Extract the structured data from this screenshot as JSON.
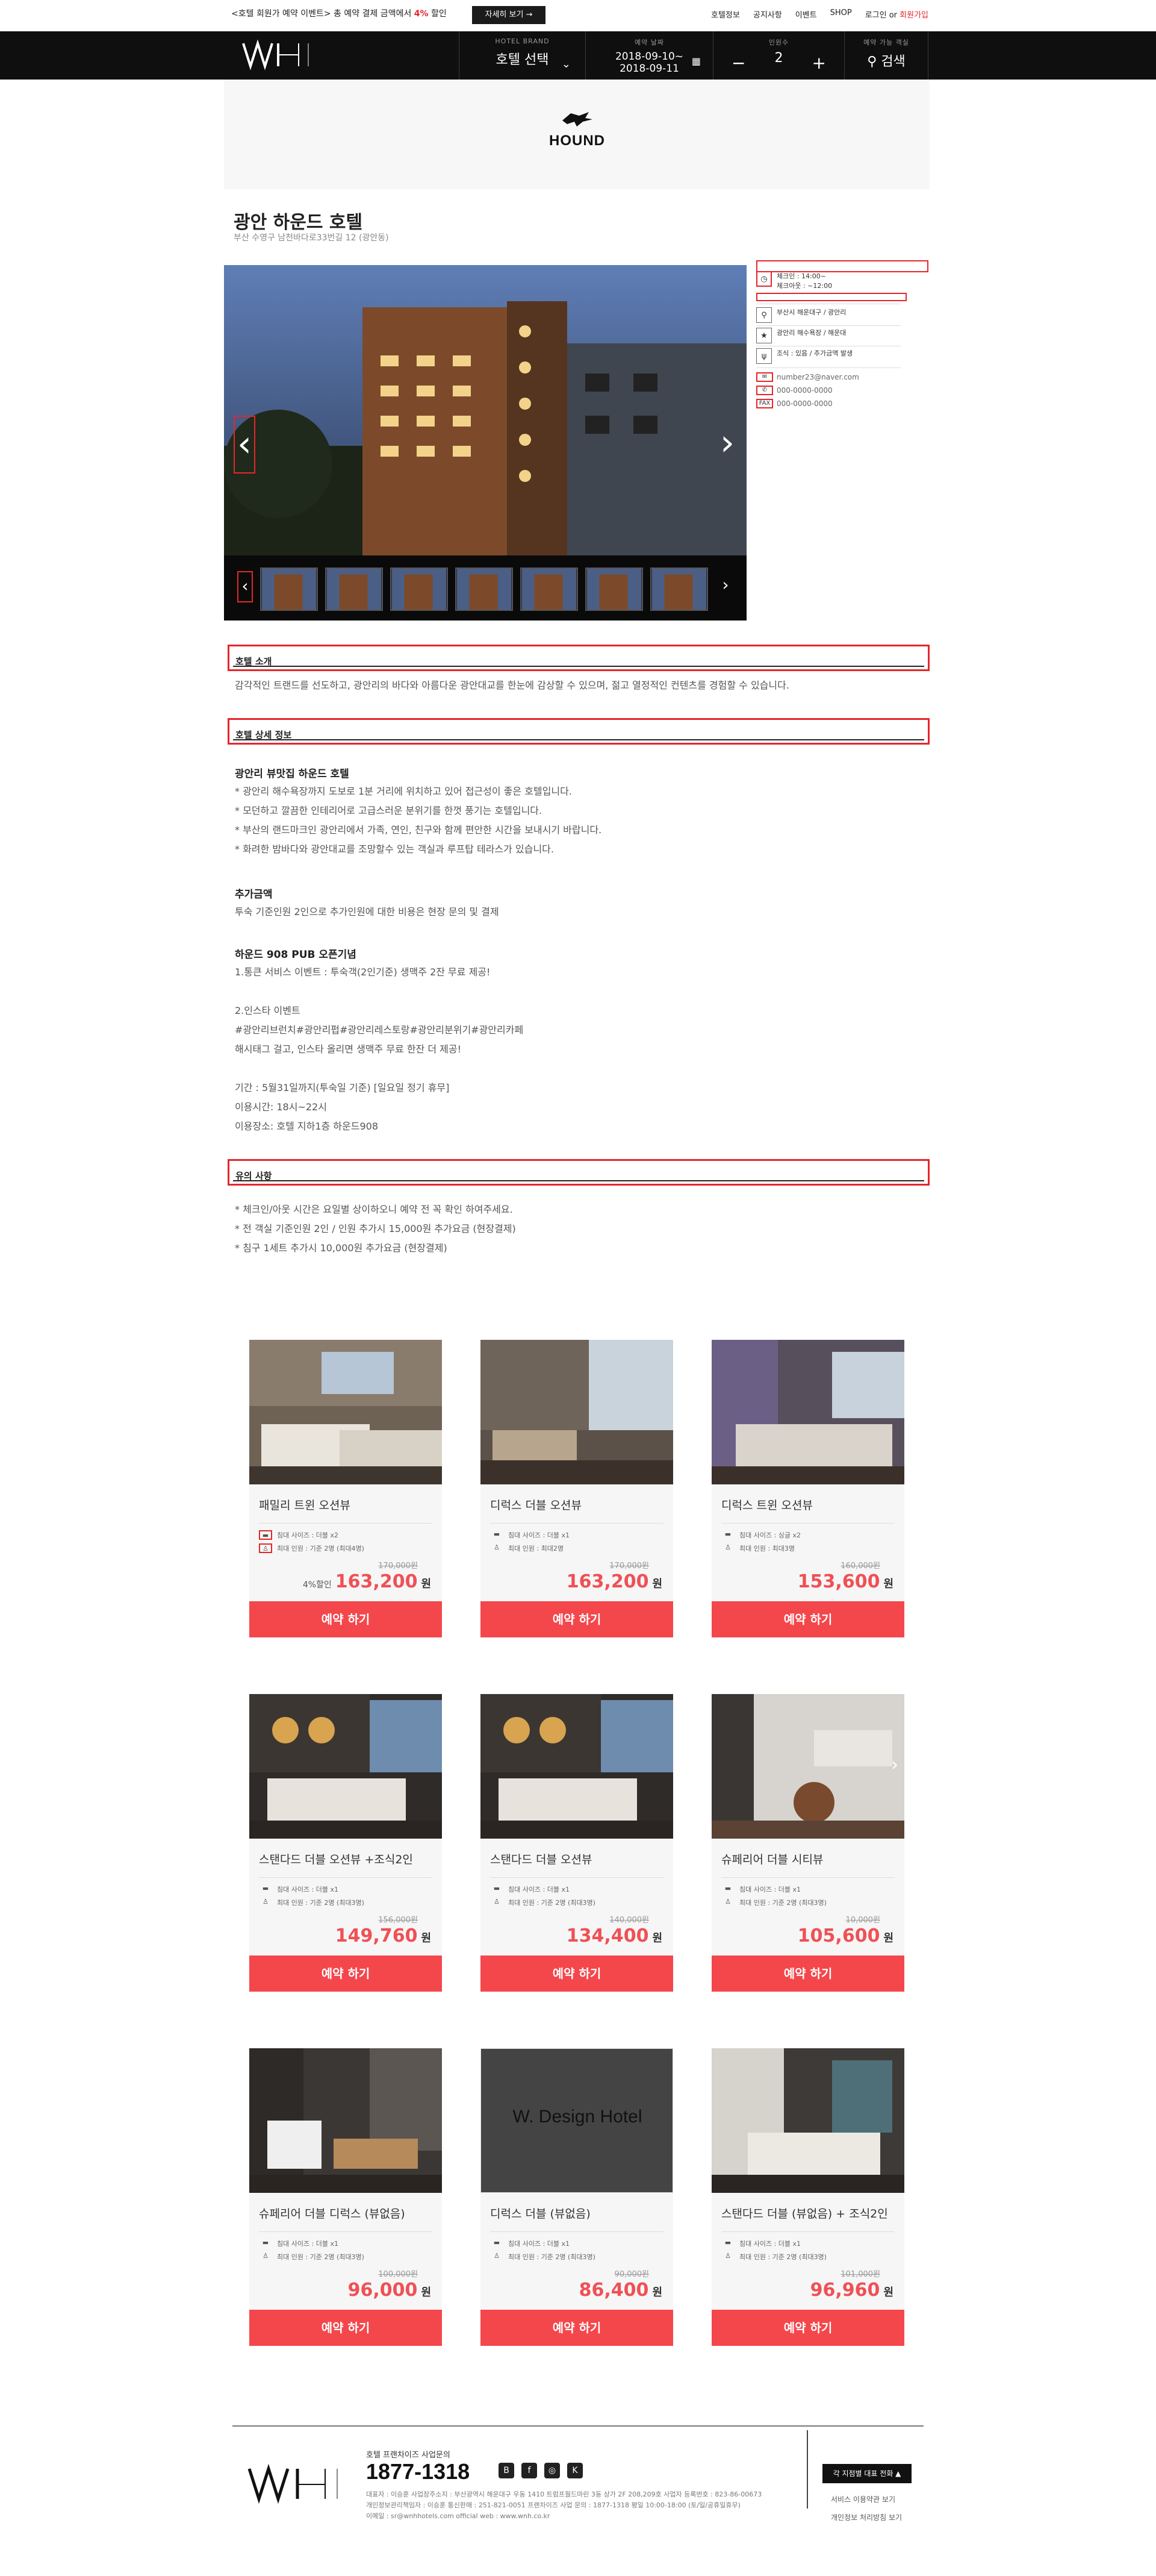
{
  "topbar": {
    "promo_prefix": "<호텔 회원가 예약 이벤트> 총 예약 결제 금액에서 ",
    "promo_pct": "4%",
    "promo_suffix": " 할인",
    "promo_button": "자세히 보기 →",
    "links": [
      "호텔정보",
      "공지사항",
      "이벤트",
      "SHOP",
      "로그인 or"
    ],
    "signup": "회원가입"
  },
  "header": {
    "brand_label": "HOTEL BRAND",
    "brand_value": "호텔 선택",
    "date_label": "예약 날짜",
    "date_from": "2018-09-10~",
    "date_to": "2018-09-11",
    "people_label": "인원수",
    "people_value": "2",
    "search_label": "예약 가능 객실",
    "search_value": "검색"
  },
  "banner": {
    "brand": "HOUND"
  },
  "hotel": {
    "name": "광안 하운드 호텔",
    "address": "부산 수영구 남천바다로33번길 12 (광안동)"
  },
  "info": {
    "checkin": "체크인       : 14:00~",
    "checkout": "체크아웃  : ~12:00",
    "location": "부산시 해운대구 / 광안리",
    "nearby": "광안리 해수욕장 / 해운대",
    "breakfast": "조식 : 있음 / 추가금액 발생",
    "email": "number23@naver.com",
    "phone": "000-0000-0000",
    "fax_label": "FAX",
    "fax": "000-0000-0000"
  },
  "sections": {
    "intro_title": "호텔 소개",
    "intro_text": "감각적인 트랜드를 선도하고, 광안리의 바다와 아름다운 광안대교를 한눈에 감상할 수 있으며, 젊고 열정적인 컨텐츠를 경험할 수 있습니다.",
    "detail_title": "호텔 상세 정보",
    "detail_sub1": "광안리 뷰맛집 하운드 호텔",
    "detail_lines1": [
      "* 광안리 해수욕장까지 도보로 1분 거리에 위치하고 있어 접근성이 좋은 호텔입니다.",
      "* 모던하고 깔끔한 인테리어로 고급스러운 분위기를 한껏 풍기는 호텔입니다.",
      "* 부산의 랜드마크인 광안리에서 가족, 연인, 친구와 함께 편안한 시간을 보내시기 바랍니다.",
      "* 화려한 밤바다와 광안대교를 조망할수 있는 객실과 루프탑 테라스가 있습니다."
    ],
    "detail_sub2": "추가금액",
    "detail_lines2": [
      "투숙 기준인원 2인으로 추가인원에 대한 비용은 현장 문의 및 결제"
    ],
    "detail_sub3": "하운드 908 PUB 오픈기념",
    "detail_lines3": [
      "1.통큰 서비스 이벤트 : 투숙객(2인기준) 생맥주 2잔 무료 제공!",
      "",
      "2.인스타 이벤트",
      "#광안리브런치#광안리펍#광안리레스토랑#광안리분위기#광안리카페",
      "해시태그 걸고, 인스타 올리면 생맥주 무료 한잔 더 제공!",
      "",
      "기간 : 5월31일까지(투숙일 기준) [일요일 정기 휴무]",
      "이용시간: 18시~22시",
      "이용장소: 호텔 지하1층 하운드908"
    ],
    "notice_title": "유의 사항",
    "notice_lines": [
      "* 체크인/아웃 시간은 요일별 상이하오니 예약 전 꼭 확인 하여주세요.",
      "* 전 객실 기준인원 2인 / 인원 추가시 15,000원 추가요금 (현장결제)",
      "* 침구 1세트 추가시 10,000원 추가요금 (현장결제)"
    ]
  },
  "rooms": [
    {
      "name": "패밀리 트윈 오션뷰",
      "bed": "침대 사이즈 : 더블 x2",
      "cap": "최대 인원 : 기준 2명 (최대4명)",
      "old": "170,000원",
      "disc": "4%할인",
      "price": "163,200",
      "won": "원",
      "book": "예약 하기",
      "img": "a"
    },
    {
      "name": "디럭스 더블 오션뷰",
      "bed": "침대 사이즈 : 더블 x1",
      "cap": "최대 인원 : 최대2명",
      "old": "170,000원",
      "disc": "",
      "price": "163,200",
      "won": "원",
      "book": "예약 하기",
      "img": "b"
    },
    {
      "name": "디럭스 트윈 오션뷰",
      "bed": "침대 사이즈 : 싱글 x2",
      "cap": "최대 인원 : 최대3명",
      "old": "160,000원",
      "disc": "",
      "price": "153,600",
      "won": "원",
      "book": "예약 하기",
      "img": "c"
    },
    {
      "name": "스탠다드 더블 오션뷰 +조식2인",
      "bed": "침대 사이즈 : 더블 x1",
      "cap": "최대 인원 : 기준 2명 (최대3명)",
      "old": "156,000원",
      "disc": "",
      "price": "149,760",
      "won": "원",
      "book": "예약 하기",
      "img": "d"
    },
    {
      "name": "스탠다드 더블 오션뷰",
      "bed": "침대 사이즈 : 더블 x1",
      "cap": "최대 인원 : 기준 2명 (최대3명)",
      "old": "140,000원",
      "disc": "",
      "price": "134,400",
      "won": "원",
      "book": "예약 하기",
      "img": "d"
    },
    {
      "name": "슈페리어 더블 시티뷰",
      "bed": "침대 사이즈 : 더블 x1",
      "cap": "최대 인원 : 기준 2명 (최대3명)",
      "old": "10,000원",
      "disc": "",
      "price": "105,600",
      "won": "원",
      "book": "예약 하기",
      "img": "e"
    },
    {
      "name": "슈페리어 더블 디럭스 (뷰없음)",
      "bed": "침대 사이즈 : 더블 x1",
      "cap": "최대 인원 : 기준 2명 (최대3명)",
      "old": "100,000원",
      "disc": "",
      "price": "96,000",
      "won": "원",
      "book": "예약 하기",
      "img": "f"
    },
    {
      "name": "디럭스 더블 (뷰없음)",
      "bed": "침대 사이즈 : 더블 x1",
      "cap": "최대 인원 : 기준 2명 (최대3명)",
      "old": "90,000원",
      "disc": "",
      "price": "86,400",
      "won": "원",
      "book": "예약 하기",
      "img": "w",
      "placeholder": "W. Design Hotel"
    },
    {
      "name": "스탠다드 더블 (뷰없음) + 조식2인",
      "bed": "침대 사이즈 : 더블 x1",
      "cap": "최대 인원 : 기준 2명 (최대3명)",
      "old": "101,000원",
      "disc": "",
      "price": "96,960",
      "won": "원",
      "book": "예약 하기",
      "img": "g"
    }
  ],
  "footer": {
    "caption": "호텔 프랜차이즈 사업문의",
    "phone": "1877-1318",
    "lines": [
      "대표자 : 이승훈   사업장주소지 : 부산광역시 해운대구 우동 1410 트럼프월드마린 3동 상가 2F 208,209호   사업자 등록번호 : 823-86-00673",
      "개인정보관리책임자 : 이승훈   통신판매 : 251-821-0051   프랜차이즈 사업 문의 : 1877-1318   평일 10:00-18:00 (토/일/공휴일휴무)",
      "이메일 : sr@wnhhotels.com   official web : www.wnh.co.kr"
    ],
    "brand_button": "각 지점별 대표 전화 ▲",
    "link1": "서비스 이용약관 보기",
    "link2": "개인정보 처리방침 보기"
  },
  "colors": {
    "accent": "#f4474c",
    "price": "#f05055",
    "header_bg": "#0f0f0f",
    "highlight": "#e6262b"
  }
}
